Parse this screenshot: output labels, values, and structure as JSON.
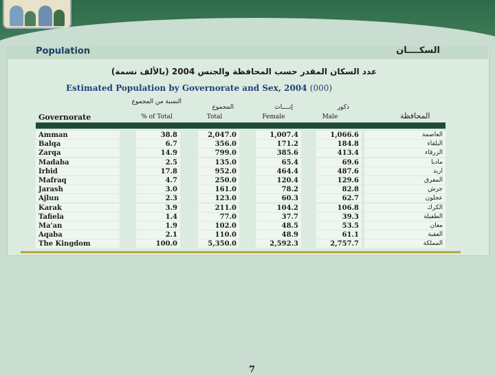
{
  "header": {
    "left_title": "Population",
    "right_title": "السكــــان"
  },
  "title": {
    "arabic": "عدد السكان المقدر حسب المحافظة والجنس 2004  (بالألف نسمة)",
    "english_main": "Estimated Population by Governorate and Sex, 2004",
    "english_unit": "(000)"
  },
  "columns": {
    "governorate": "Governorate",
    "percent_ar": "النسبة من المجموع",
    "percent_en": "%   of Total",
    "total_ar": "المجموع",
    "total_en": "Total",
    "female_ar": "إنــــاث",
    "female_en": "Female",
    "male_ar": "ذكور",
    "male_en": "Male",
    "governorate_ar": "المحافظة"
  },
  "rows": [
    {
      "gov": "Amman",
      "pct": "38.8",
      "total": "2,047.0",
      "female": "1,007.4",
      "male": "1,066.6",
      "gov_ar": "العاصمة"
    },
    {
      "gov": "Balqa",
      "pct": "6.7",
      "total": "356.0",
      "female": "171.2",
      "male": "184.8",
      "gov_ar": "البلقاء"
    },
    {
      "gov": "Zarqa",
      "pct": "14.9",
      "total": "799.0",
      "female": "385.6",
      "male": "413.4",
      "gov_ar": "الزرقاء"
    },
    {
      "gov": "Madaba",
      "pct": "2.5",
      "total": "135.0",
      "female": "65.4",
      "male": "69.6",
      "gov_ar": "مادبا"
    },
    {
      "gov": "Irbid",
      "pct": "17.8",
      "total": "952.0",
      "female": "464.4",
      "male": "487.6",
      "gov_ar": "اربد"
    },
    {
      "gov": "Mafraq",
      "pct": "4.7",
      "total": "250.0",
      "female": "120.4",
      "male": "129.6",
      "gov_ar": "المفرق"
    },
    {
      "gov": "Jarash",
      "pct": "3.0",
      "total": "161.0",
      "female": "78.2",
      "male": "82.8",
      "gov_ar": "جرش"
    },
    {
      "gov": "Ajlun",
      "pct": "2.3",
      "total": "123.0",
      "female": "60.3",
      "male": "62.7",
      "gov_ar": "عجلون"
    },
    {
      "gov": "Karak",
      "pct": "3.9",
      "total": "211.0",
      "female": "104.2",
      "male": "106.8",
      "gov_ar": "الكرك"
    },
    {
      "gov": "Tafiela",
      "pct": "1.4",
      "total": "77.0",
      "female": "37.7",
      "male": "39.3",
      "gov_ar": "الطفيلة"
    },
    {
      "gov": "Ma'an",
      "pct": "1.9",
      "total": "102.0",
      "female": "48.5",
      "male": "53.5",
      "gov_ar": "معان"
    },
    {
      "gov": "Aqaba",
      "pct": "2.1",
      "total": "110.0",
      "female": "48.9",
      "male": "61.1",
      "gov_ar": "العقبة"
    },
    {
      "gov": "The Kingdom",
      "pct": "100.0",
      "total": "5,350.0",
      "female": "2,592.3",
      "male": "2,757.7",
      "gov_ar": "المملكة"
    }
  ],
  "page_number": "7"
}
